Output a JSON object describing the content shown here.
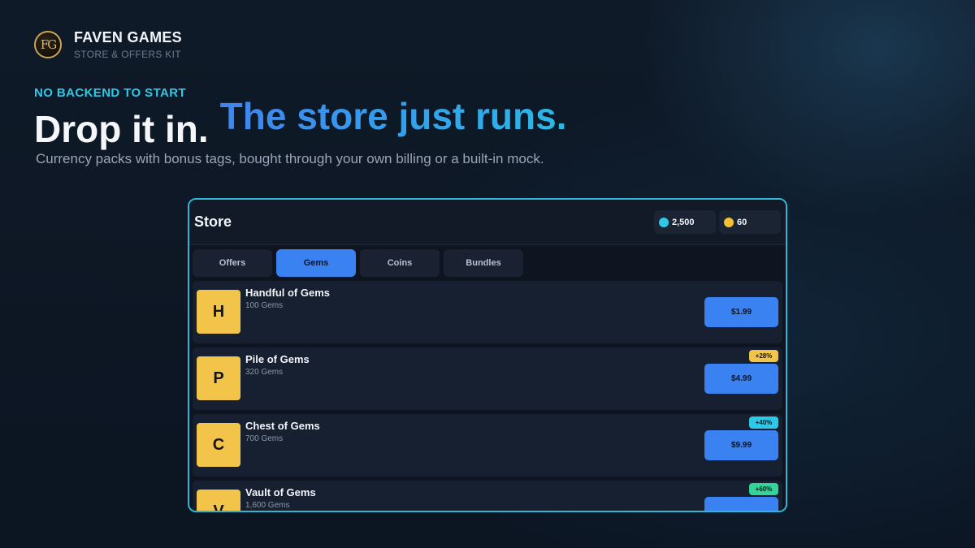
{
  "brand": {
    "logo_text": "FG",
    "name": "FAVEN GAMES",
    "subtitle": "STORE & OFFERS KIT"
  },
  "hero": {
    "eyebrow": "NO BACKEND TO START",
    "headline_primary": "Drop it in.",
    "headline_accent": "The store just runs.",
    "subline": "Currency packs with bonus tags, bought through your own billing or a built-in mock."
  },
  "store": {
    "title": "Store",
    "wallet": [
      {
        "icon": "gem-icon",
        "amount": "2,500",
        "color": "#2ec9e6"
      },
      {
        "icon": "coin-icon",
        "amount": "60",
        "color": "#f3c233"
      }
    ],
    "tabs": [
      {
        "label": "Offers",
        "active": false
      },
      {
        "label": "Gems",
        "active": true
      },
      {
        "label": "Coins",
        "active": false
      },
      {
        "label": "Bundles",
        "active": false
      }
    ],
    "items": [
      {
        "letter": "H",
        "name": "Handful of Gems",
        "desc": "100 Gems",
        "price": "$1.99",
        "bonus": "",
        "bonus_color": ""
      },
      {
        "letter": "P",
        "name": "Pile of Gems",
        "desc": "320 Gems",
        "price": "$4.99",
        "bonus": "+28%",
        "bonus_color": "#f3c44a"
      },
      {
        "letter": "C",
        "name": "Chest of Gems",
        "desc": "700 Gems",
        "price": "$9.99",
        "bonus": "+40%",
        "bonus_color": "#2ec9e6"
      },
      {
        "letter": "V",
        "name": "Vault of Gems",
        "desc": "1,600 Gems",
        "price": "",
        "bonus": "+60%",
        "bonus_color": "#34d39a"
      }
    ]
  },
  "colors": {
    "accent_blue": "#3a82f2",
    "accent_cyan": "#2ec9e6",
    "panel_border": "#2fb6d6"
  }
}
